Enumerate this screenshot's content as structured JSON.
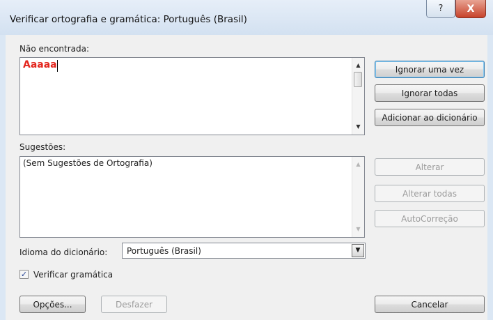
{
  "window": {
    "title": "Verificar ortografia e gramática: Português (Brasil)",
    "help_glyph": "?",
    "close_glyph": "X"
  },
  "not_found": {
    "label": "Não encontrada:",
    "word": "Aaaaa"
  },
  "suggestions": {
    "label": "Sugestões:",
    "items": [
      "(Sem Sugestões de Ortografia)"
    ]
  },
  "buttons": {
    "ignore_once": "Ignorar uma vez",
    "ignore_all": "Ignorar todas",
    "add_dictionary": "Adicionar ao dicionário",
    "change": "Alterar",
    "change_all": "Alterar todas",
    "autocorrect": "AutoCorreção",
    "options": "Opções...",
    "undo": "Desfazer",
    "cancel": "Cancelar"
  },
  "dictionary": {
    "label": "Idioma do dicionário:",
    "value": "Português (Brasil)"
  },
  "check_grammar": {
    "label": "Verificar gramática",
    "checked": true
  },
  "icons": {
    "scroll_up": "scroll-up-arrow",
    "scroll_down": "scroll-down-arrow",
    "dropdown": "chevron-down",
    "checkmark": "checkmark"
  },
  "colors": {
    "misspelled": "#e3261e",
    "default_button_border": "#3c7fb1",
    "title_bar": "#dbe7f4",
    "close_button": "#c7432b"
  }
}
